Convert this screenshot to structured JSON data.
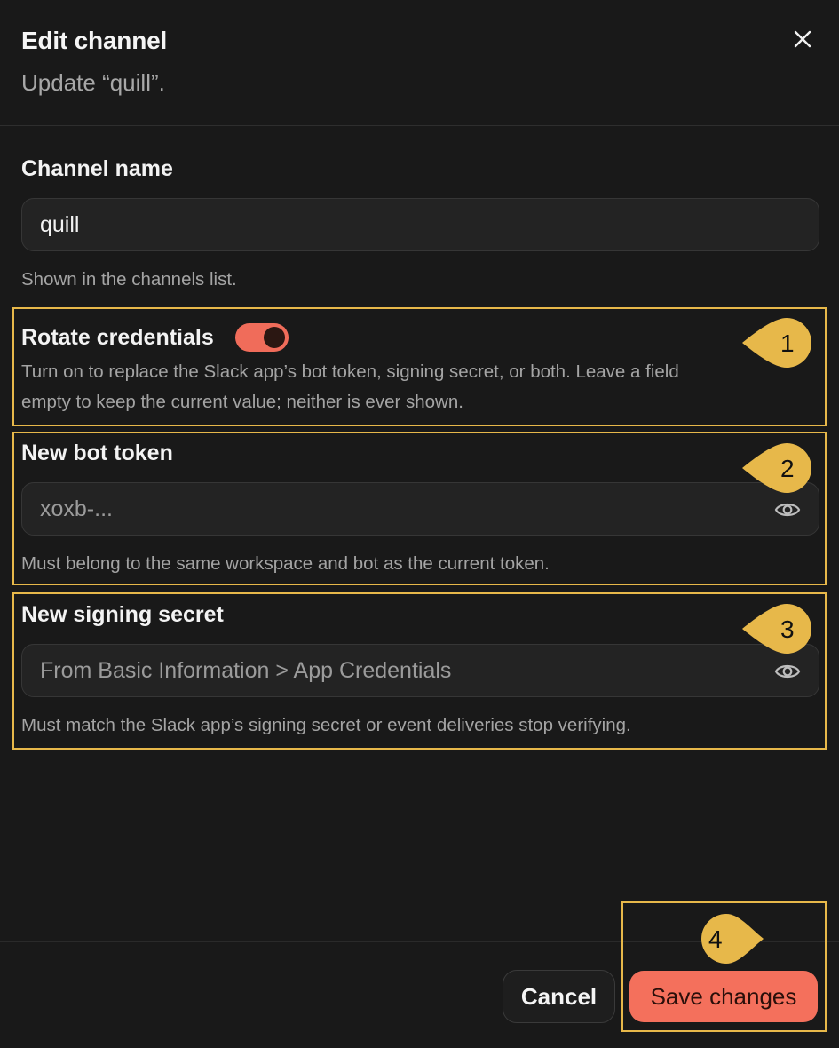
{
  "dialog": {
    "title": "Edit channel",
    "subtitle": "Update “quill”."
  },
  "channel_name": {
    "label": "Channel name",
    "value": "quill",
    "help": "Shown in the channels list."
  },
  "rotate": {
    "label": "Rotate credentials",
    "enabled": true,
    "help_line1": "Turn on to replace the Slack app’s bot token, signing secret, or both. Leave a field",
    "help_line2": "empty to keep the current value; neither is ever shown."
  },
  "bot_token": {
    "label": "New bot token",
    "placeholder": "xoxb-...",
    "help": "Must belong to the same workspace and bot as the current token."
  },
  "signing_secret": {
    "label": "New signing secret",
    "placeholder": "From Basic Information > App Credentials",
    "help": "Must match the Slack app’s signing secret or event deliveries stop verifying."
  },
  "footer": {
    "cancel": "Cancel",
    "save": "Save changes"
  },
  "annotations": [
    "1",
    "2",
    "3",
    "4"
  ],
  "colors": {
    "accent": "#f4705c",
    "highlight": "#e7b84a",
    "background": "#191919"
  },
  "icons": [
    "close-icon",
    "eye-icon",
    "eye-icon"
  ]
}
